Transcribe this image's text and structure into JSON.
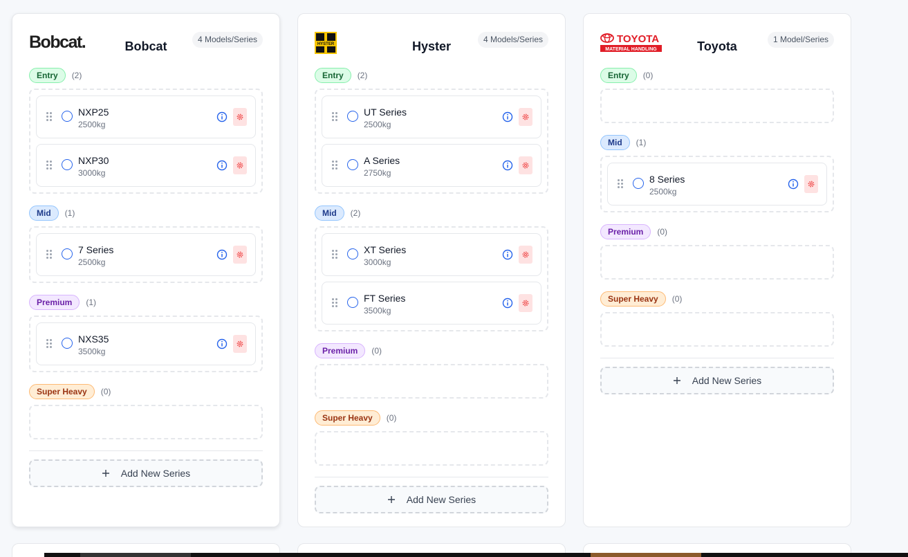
{
  "brands": [
    {
      "name": "Bobcat",
      "logo_text": "Bobcat.",
      "count_label": "4 Models/Series",
      "tiers": [
        {
          "label": "Entry",
          "count": "(2)",
          "items": [
            {
              "name": "NXP25",
              "cap": "2500kg"
            },
            {
              "name": "NXP30",
              "cap": "3000kg"
            }
          ]
        },
        {
          "label": "Mid",
          "count": "(1)",
          "items": [
            {
              "name": "7 Series",
              "cap": "2500kg"
            }
          ]
        },
        {
          "label": "Premium",
          "count": "(1)",
          "items": [
            {
              "name": "NXS35",
              "cap": "3500kg"
            }
          ]
        },
        {
          "label": "Super Heavy",
          "count": "(0)",
          "items": []
        }
      ],
      "add_label": "Add New Series"
    },
    {
      "name": "Hyster",
      "logo_text": "HYSTER",
      "count_label": "4 Models/Series",
      "tiers": [
        {
          "label": "Entry",
          "count": "(2)",
          "items": [
            {
              "name": "UT Series",
              "cap": "2500kg"
            },
            {
              "name": "A Series",
              "cap": "2750kg"
            }
          ]
        },
        {
          "label": "Mid",
          "count": "(2)",
          "items": [
            {
              "name": "XT Series",
              "cap": "3000kg"
            },
            {
              "name": "FT Series",
              "cap": "3500kg"
            }
          ]
        },
        {
          "label": "Premium",
          "count": "(0)",
          "items": []
        },
        {
          "label": "Super Heavy",
          "count": "(0)",
          "items": []
        }
      ],
      "add_label": "Add New Series"
    },
    {
      "name": "Toyota",
      "logo_text": "TOYOTA",
      "logo_subtext": "MATERIAL HANDLING",
      "count_label": "1 Model/Series",
      "tiers": [
        {
          "label": "Entry",
          "count": "(0)",
          "items": []
        },
        {
          "label": "Mid",
          "count": "(1)",
          "items": [
            {
              "name": "8 Series",
              "cap": "2500kg"
            }
          ]
        },
        {
          "label": "Premium",
          "count": "(0)",
          "items": []
        },
        {
          "label": "Super Heavy",
          "count": "(0)",
          "items": []
        }
      ],
      "add_label": "Add New Series"
    }
  ],
  "colors": {
    "accent": "#2563eb",
    "danger": "#ef4444",
    "entry": "#166534",
    "mid": "#1e3a8a",
    "premium": "#6b21a8",
    "super_heavy": "#9a3412"
  },
  "icons": {
    "drag": "grip-vertical-icon",
    "select": "radio-circle-icon",
    "info": "info-icon",
    "settings": "gear-icon",
    "add": "plus-icon"
  }
}
